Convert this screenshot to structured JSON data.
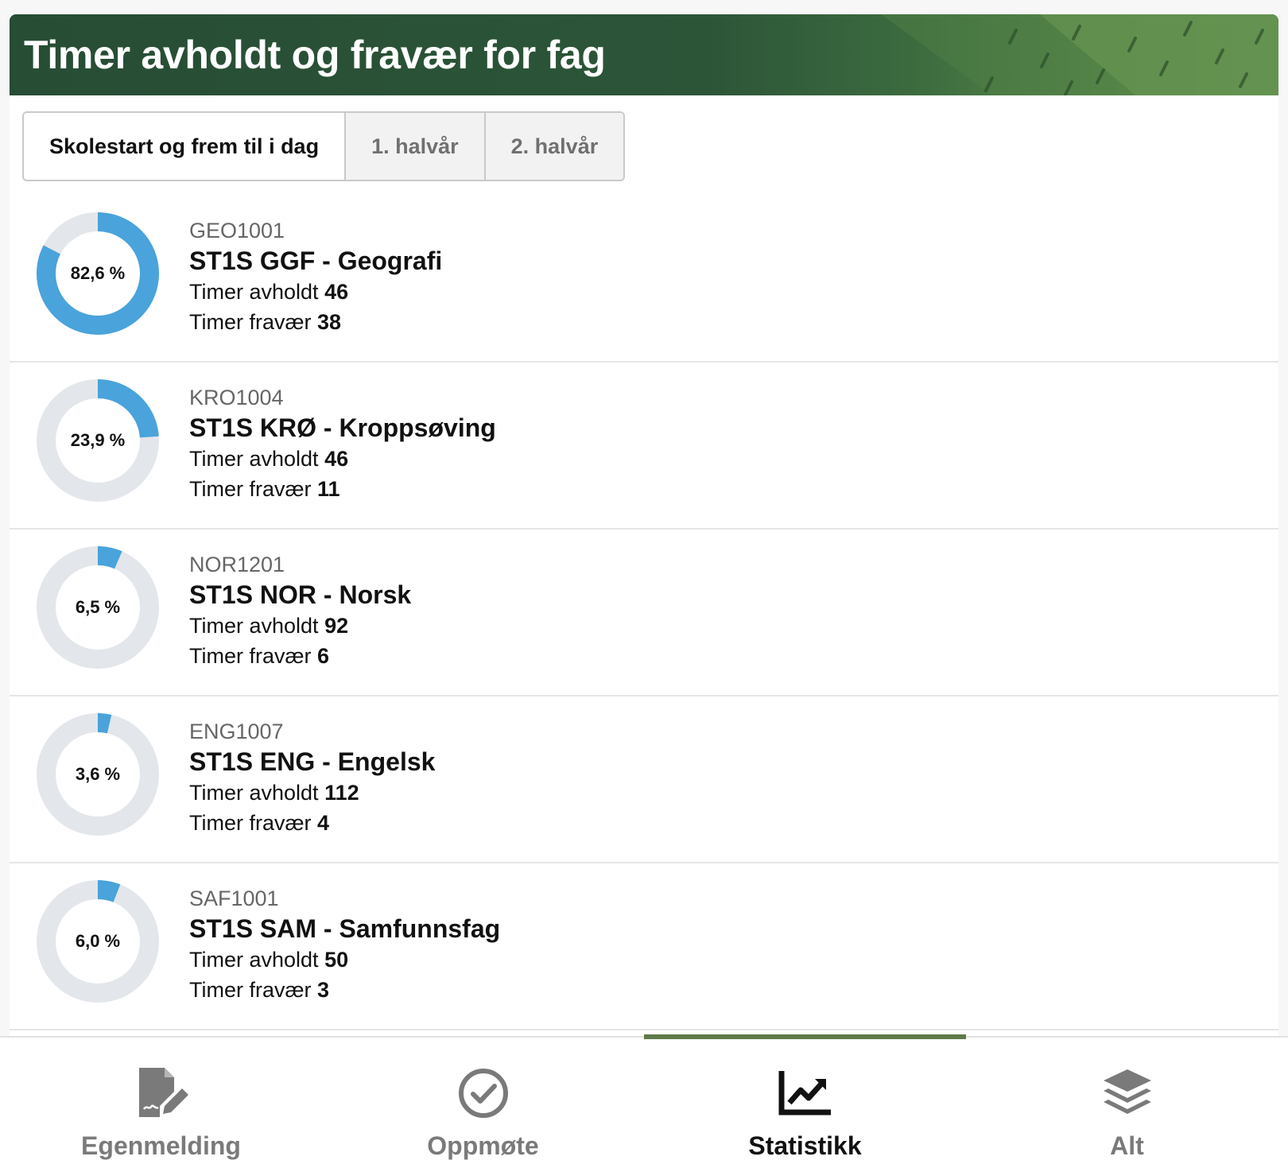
{
  "header": {
    "title": "Timer avholdt og fravær for fag"
  },
  "period_tabs": [
    {
      "label": "Skolestart og frem til i dag",
      "active": true
    },
    {
      "label": "1. halvår",
      "active": false
    },
    {
      "label": "2. halvår",
      "active": false
    }
  ],
  "colors": {
    "accent": "#4aa3db",
    "track": "#e3e6ea",
    "active_tab_bar": "#5f7a48"
  },
  "subjects": [
    {
      "code": "GEO1001",
      "name": "ST1S GGF - Geografi",
      "percent": 82.6,
      "percent_label": "82,6 %",
      "held_label": "Timer avholdt",
      "held": "46",
      "absence_label": "Timer fravær",
      "absence": "38"
    },
    {
      "code": "KRO1004",
      "name": "ST1S KRØ - Kroppsøving",
      "percent": 23.9,
      "percent_label": "23,9 %",
      "held_label": "Timer avholdt",
      "held": "46",
      "absence_label": "Timer fravær",
      "absence": "11"
    },
    {
      "code": "NOR1201",
      "name": "ST1S NOR - Norsk",
      "percent": 6.5,
      "percent_label": "6,5 %",
      "held_label": "Timer avholdt",
      "held": "92",
      "absence_label": "Timer fravær",
      "absence": "6"
    },
    {
      "code": "ENG1007",
      "name": "ST1S ENG - Engelsk",
      "percent": 3.6,
      "percent_label": "3,6 %",
      "held_label": "Timer avholdt",
      "held": "112",
      "absence_label": "Timer fravær",
      "absence": "4"
    },
    {
      "code": "SAF1001",
      "name": "ST1S SAM - Samfunnsfag",
      "percent": 6.0,
      "percent_label": "6,0 %",
      "held_label": "Timer avholdt",
      "held": "50",
      "absence_label": "Timer fravær",
      "absence": "3"
    }
  ],
  "bottom_nav": [
    {
      "label": "Egenmelding",
      "icon": "file-signature-icon",
      "active": false
    },
    {
      "label": "Oppmøte",
      "icon": "check-circle-icon",
      "active": false
    },
    {
      "label": "Statistikk",
      "icon": "chart-line-icon",
      "active": true
    },
    {
      "label": "Alt",
      "icon": "layers-icon",
      "active": false
    }
  ]
}
